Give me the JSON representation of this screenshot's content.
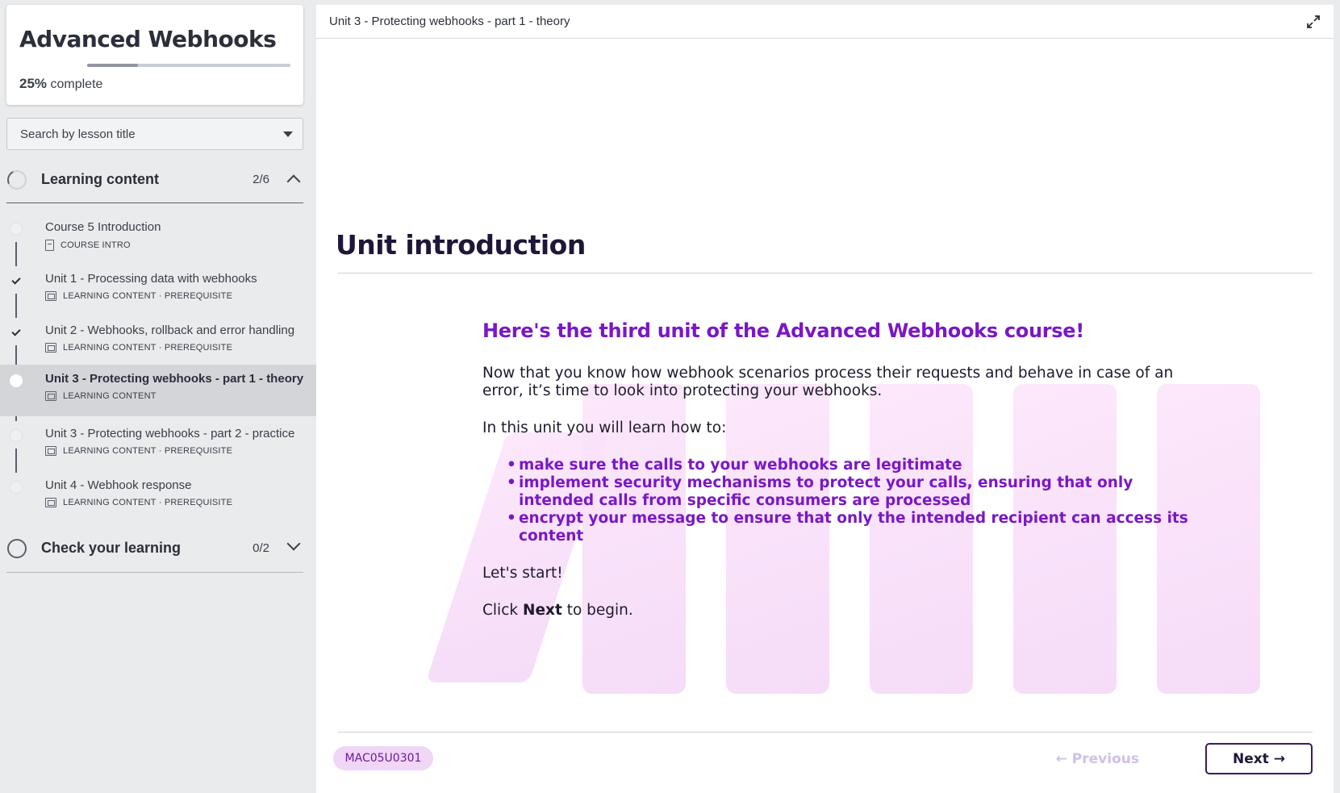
{
  "sidebar": {
    "course_title": "Advanced Webhooks",
    "progress_percent": 25,
    "progress_percent_label": "25%",
    "progress_suffix": "complete",
    "search_placeholder": "Search by lesson title",
    "sections": [
      {
        "label": "Learning content",
        "count": "2/6",
        "expanded": true,
        "lessons": [
          {
            "title": "Course 5 Introduction",
            "meta": "COURSE INTRO",
            "status": "not-started"
          },
          {
            "title": "Unit 1 - Processing data with webhooks",
            "meta": "LEARNING CONTENT · PREREQUISITE",
            "status": "completed"
          },
          {
            "title": "Unit 2 - Webhooks, rollback and error handling",
            "meta": "LEARNING CONTENT · PREREQUISITE",
            "status": "completed"
          },
          {
            "title": "Unit 3 - Protecting webhooks - part 1 - theory",
            "meta": "LEARNING CONTENT",
            "status": "active"
          },
          {
            "title": "Unit 3 - Protecting webhooks - part 2 - practice",
            "meta": "LEARNING CONTENT · PREREQUISITE",
            "status": "not-started"
          },
          {
            "title": "Unit 4 - Webhook response",
            "meta": "LEARNING CONTENT · PREREQUISITE",
            "status": "not-started"
          }
        ]
      },
      {
        "label": "Check your learning",
        "count": "0/2",
        "expanded": false
      }
    ]
  },
  "main": {
    "breadcrumb": "Unit 3 - Protecting webhooks - part 1 - theory",
    "heading": "Unit introduction",
    "lead": "Here's the third unit of the Advanced Webhooks course!",
    "paragraph_1": "Now that you know how webhook scenarios process their requests and behave in case of an error, it’s time to look into protecting your webhooks.",
    "paragraph_2": "In this unit you will learn how to:",
    "bullets": [
      "make sure the calls to your webhooks are legitimate",
      "implement security mechanisms to protect your calls, ensuring that only intended calls from specific consumers are processed",
      "encrypt your message to ensure that only the intended recipient can access its content"
    ],
    "paragraph_3": "Let's start!",
    "click_prefix": "Click",
    "click_bold": "Next",
    "click_suffix": "to begin.",
    "code_badge": "MAC05U0301",
    "prev_label": "← Previous",
    "next_label": "Next →"
  },
  "colors": {
    "accent_purple": "#7a17c6",
    "next_border": "#3b1a63",
    "badge_bg": "#f0d6f7"
  }
}
